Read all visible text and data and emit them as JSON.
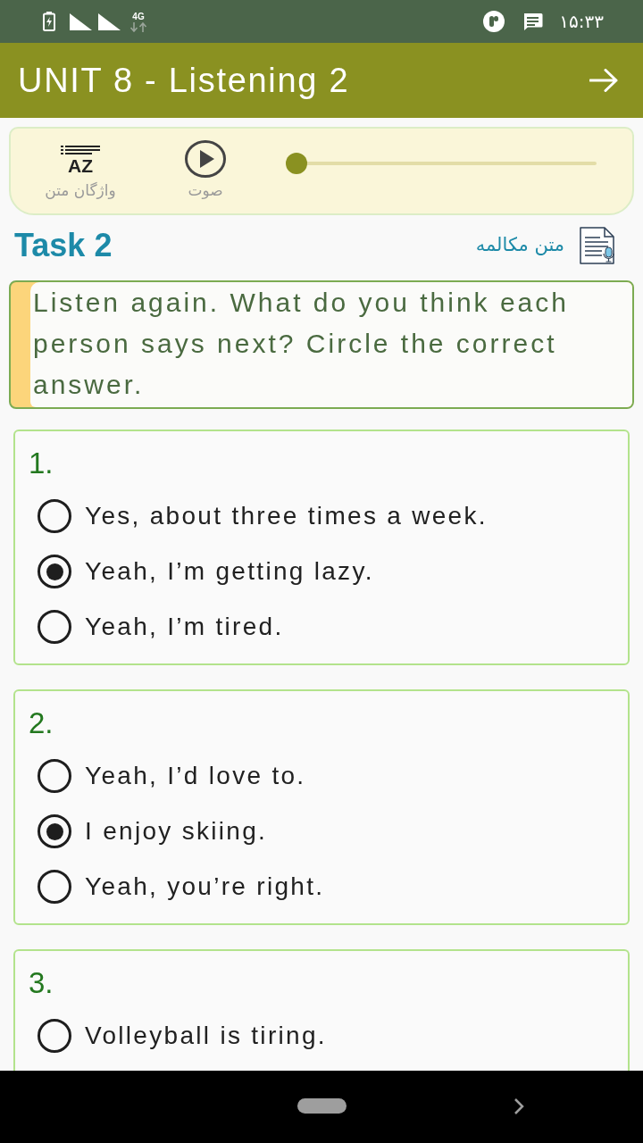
{
  "status_bar": {
    "network": "4G",
    "time": "۱۵:۳۳"
  },
  "app_bar": {
    "title": "UNIT 8 - Listening 2"
  },
  "player": {
    "vocab_icon_letters": "AZ",
    "vocab_label": "واژگان متن",
    "audio_label": "صوت",
    "level": 0
  },
  "task": {
    "title": "Task 2",
    "transcript_label": "متن مکالمه",
    "instruction": "Listen again. What do you think each person says next? Circle the correct answer."
  },
  "questions": [
    {
      "number": "1.",
      "options": [
        {
          "text": "Yes, about three times a week.",
          "selected": false
        },
        {
          "text": "Yeah, I’m getting lazy.",
          "selected": true
        },
        {
          "text": "Yeah, I’m tired.",
          "selected": false
        }
      ]
    },
    {
      "number": "2.",
      "options": [
        {
          "text": "Yeah, I’d love to.",
          "selected": false
        },
        {
          "text": "I enjoy skiing.",
          "selected": true
        },
        {
          "text": "Yeah, you’re right.",
          "selected": false
        }
      ]
    },
    {
      "number": "3.",
      "options": [
        {
          "text": "Volleyball is tiring.",
          "selected": false
        }
      ]
    }
  ]
}
